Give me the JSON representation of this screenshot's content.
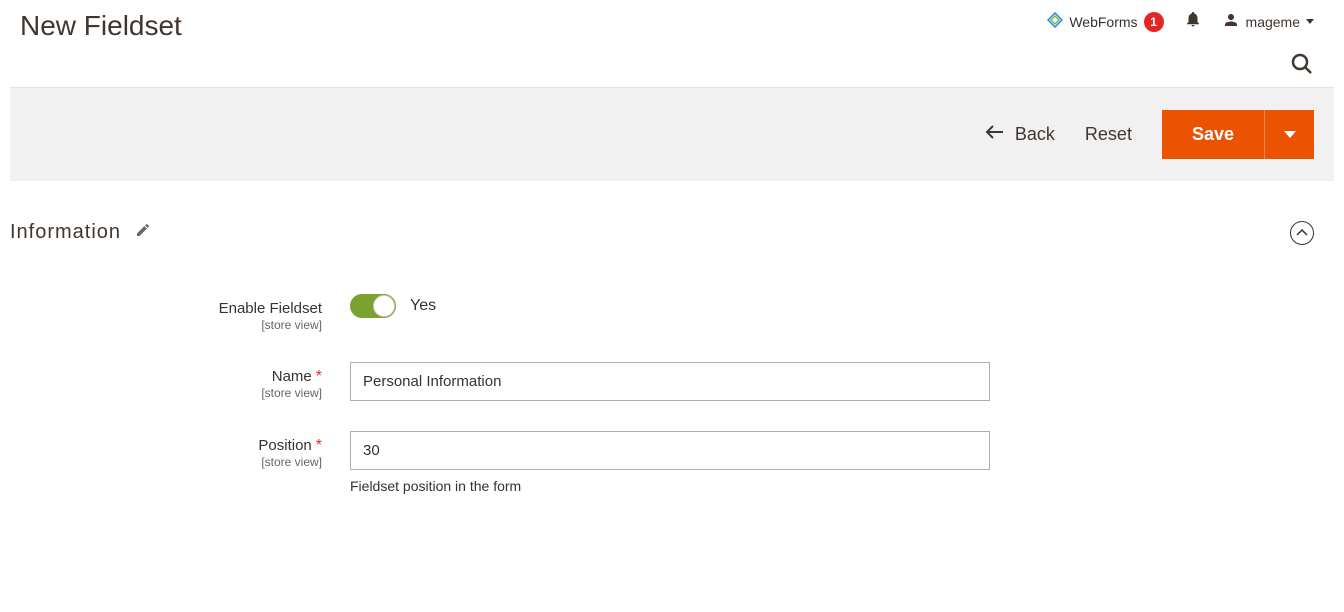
{
  "header": {
    "title": "New Fieldset",
    "webforms_label": "WebForms",
    "webforms_badge": "1",
    "username": "mageme"
  },
  "actions": {
    "back": "Back",
    "reset": "Reset",
    "save": "Save"
  },
  "section": {
    "title": "Information"
  },
  "form": {
    "enable": {
      "label": "Enable Fieldset",
      "scope": "[store view]",
      "value_label": "Yes"
    },
    "name": {
      "label": "Name",
      "scope": "[store view]",
      "value": "Personal Information"
    },
    "position": {
      "label": "Position",
      "scope": "[store view]",
      "value": "30",
      "help": "Fieldset position in the form"
    }
  }
}
